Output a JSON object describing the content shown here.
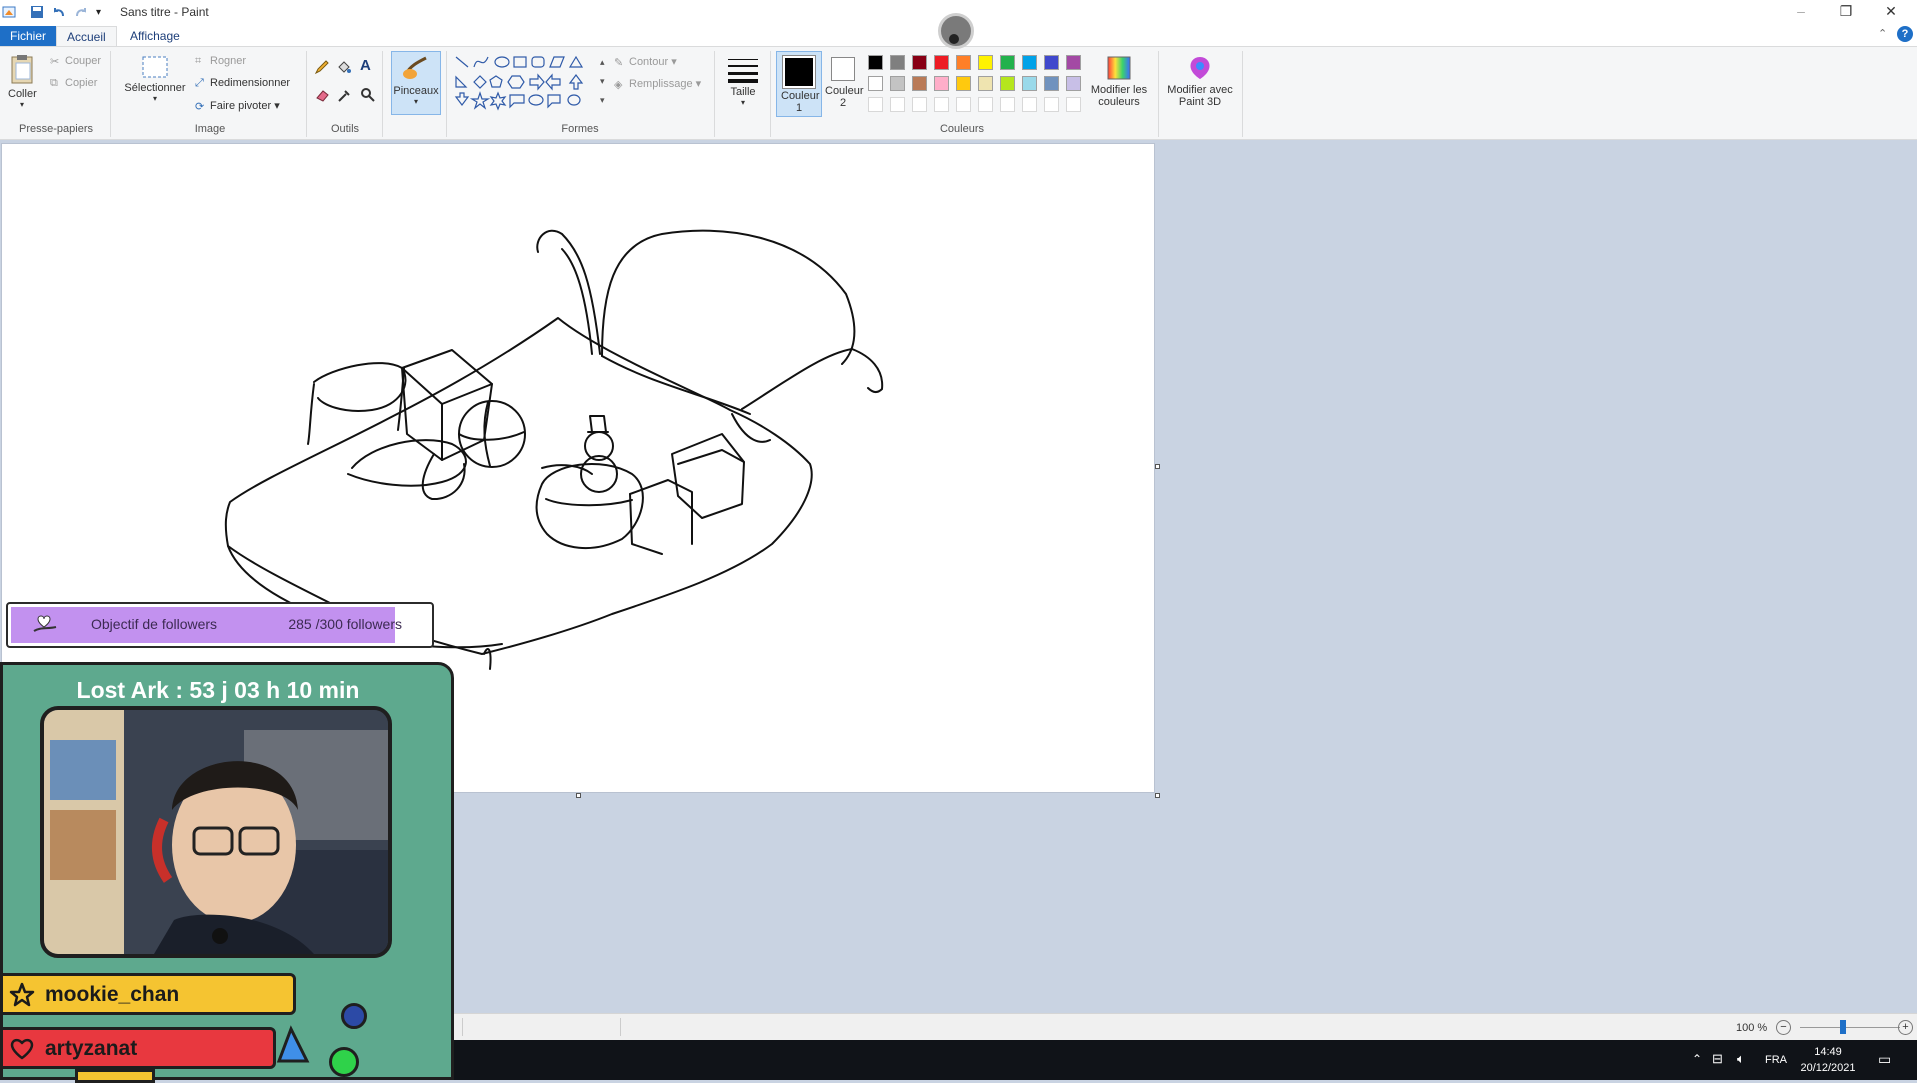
{
  "window": {
    "title": "Sans titre - Paint",
    "controls": [
      "minimize",
      "restore",
      "close"
    ]
  },
  "menu_tabs": [
    "Fichier",
    "Accueil",
    "Affichage"
  ],
  "ribbon": {
    "clipboard": {
      "paste_label": "Coller",
      "cut_label": "Couper",
      "copy_label": "Copier",
      "group_label": "Presse-papiers"
    },
    "image": {
      "select_label": "Sélectionner",
      "crop_label": "Rogner",
      "resize_label": "Redimensionner",
      "rotate_label": "Faire pivoter",
      "group_label": "Image"
    },
    "tools": {
      "group_label": "Outils"
    },
    "brushes": {
      "label": "Pinceaux"
    },
    "shapes": {
      "outline_label": "Contour",
      "fill_label": "Remplissage",
      "group_label": "Formes"
    },
    "size": {
      "label": "Taille"
    },
    "color1": {
      "label": "Couleur 1",
      "value": "#000000"
    },
    "color2": {
      "label": "Couleur 2",
      "value": "#ffffff"
    },
    "colors": {
      "group_label": "Couleurs",
      "palette_row1": [
        "#000000",
        "#7f7f7f",
        "#880015",
        "#ed1c24",
        "#ff7f27",
        "#fff200",
        "#22b14c",
        "#00a2e8",
        "#3f48cc",
        "#a349a4"
      ],
      "palette_row2": [
        "#ffffff",
        "#c3c3c3",
        "#b97a57",
        "#ffaec9",
        "#ffc90e",
        "#efe4b0",
        "#b5e61d",
        "#99d9ea",
        "#7092be",
        "#c8bfe7"
      ],
      "edit_colors_label": "Modifier les couleurs"
    },
    "paint3d": {
      "label": "Modifier avec Paint 3D"
    }
  },
  "statusbar": {
    "zoom": "100 %"
  },
  "taskbar": {
    "language": "FRA",
    "time": "14:49",
    "date": "20/12/2021"
  },
  "overlay": {
    "follow_goal": {
      "label": "Objectif de followers",
      "count": "285 /300 followers",
      "progress": 0.95
    },
    "countdown": "Lost Ark : 53 j 03 h 10 min",
    "banners": [
      {
        "name": "mookie_chan",
        "icon": "star-icon",
        "color": "#f5c431"
      },
      {
        "name": "artyzanat",
        "icon": "heart-icon",
        "color": "#e8383f"
      }
    ]
  }
}
